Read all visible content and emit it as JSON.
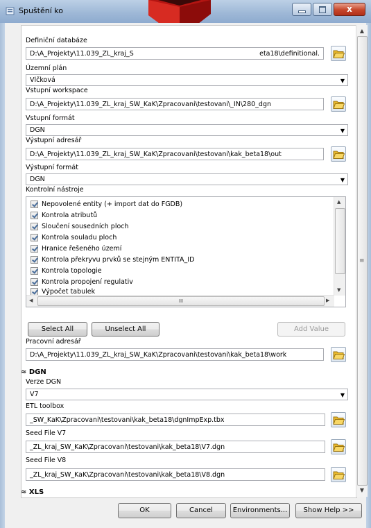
{
  "window": {
    "title": "Spuštění ko",
    "close_glyph": "x"
  },
  "form": {
    "definicni_databaze": {
      "label": "Definiční databáze",
      "value": "D:\\A_Projekty\\11.039_ZL_kraj_S",
      "value_tail": "eta18\\definitional."
    },
    "uzemni_plan": {
      "label": "Územní plán",
      "value": "Vlčková"
    },
    "vstupni_workspace": {
      "label": "Vstupní workspace",
      "value": "D:\\A_Projekty\\11.039_ZL_kraj_SW_KaK\\Zpracovani\\testovani\\_IN\\280_dgn"
    },
    "vstupni_format": {
      "label": "Vstupní formát",
      "value": "DGN"
    },
    "vystupni_adresar": {
      "label": "Výstupní adresář",
      "value": "D:\\A_Projekty\\11.039_ZL_kraj_SW_KaK\\Zpracovani\\testovani\\kak_beta18\\out"
    },
    "vystupni_format": {
      "label": "Výstupní formát",
      "value": "DGN"
    },
    "kontrolni_nastroje": {
      "label": "Kontrolní nástroje",
      "items": [
        "Nepovolené entity (+ import dat do FGDB)",
        "Kontrola atributů",
        "Sloučení sousedních ploch",
        "Kontrola souladu ploch",
        "Hranice řešeného území",
        "Kontrola překryvu prvků se stejným ENTITA_ID",
        "Kontrola topologie",
        "Kontrola propojení regulativ",
        "Výpočet tabulek"
      ],
      "hscroll_grip": "III"
    },
    "buttons": {
      "select_all": "Select All",
      "unselect_all": "Unselect All",
      "add_value": "Add Value"
    },
    "pracovni_adresar": {
      "label": "Pracovní adresář",
      "value": "D:\\A_Projekty\\11.039_ZL_kraj_SW_KaK\\Zpracovani\\testovani\\kak_beta18\\work"
    }
  },
  "dgn": {
    "section_title": "DGN",
    "verze_dgn": {
      "label": "Verze DGN",
      "value": "V7"
    },
    "etl_toolbox": {
      "label": "ETL toolbox",
      "value": "_SW_KaK\\Zpracovani\\testovani\\kak_beta18\\dgnImpExp.tbx"
    },
    "seed_v7": {
      "label": "Seed File V7",
      "value": "_ZL_kraj_SW_KaK\\Zpracovani\\testovani\\kak_beta18\\V7.dgn"
    },
    "seed_v8": {
      "label": "Seed File V8",
      "value": "_ZL_kraj_SW_KaK\\Zpracovani\\testovani\\kak_beta18\\V8.dgn"
    }
  },
  "xls": {
    "section_title": "XLS"
  },
  "footer": {
    "ok": "OK",
    "cancel": "Cancel",
    "environments": "Environments...",
    "show_help": "Show Help >>"
  },
  "colors": {
    "title_bar": "#9db7d6",
    "body_bg": "#f0f0f0",
    "folder_yellow": "#f2c94c",
    "logo_red": "#c8201e"
  }
}
